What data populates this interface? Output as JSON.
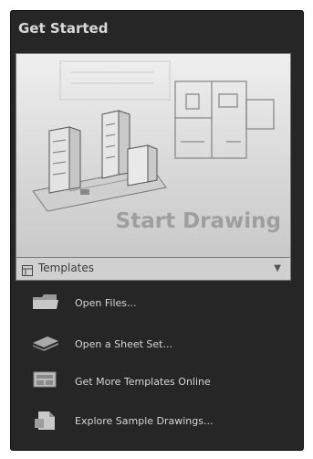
{
  "panel": {
    "title": "Get Started",
    "start_drawing_label": "Start Drawing",
    "templates_label": "Templates",
    "menu": [
      {
        "label": "Open Files...",
        "icon": "folder-icon"
      },
      {
        "label": "Open a Sheet Set...",
        "icon": "sheet-set-icon"
      },
      {
        "label": "Get More Templates Online",
        "icon": "online-templates-icon"
      },
      {
        "label": "Explore Sample Drawings...",
        "icon": "sample-drawings-icon"
      }
    ]
  },
  "colors": {
    "panel_bg": "#262626",
    "text": "#d6d6d6",
    "card_text": "#9e9e9e"
  }
}
